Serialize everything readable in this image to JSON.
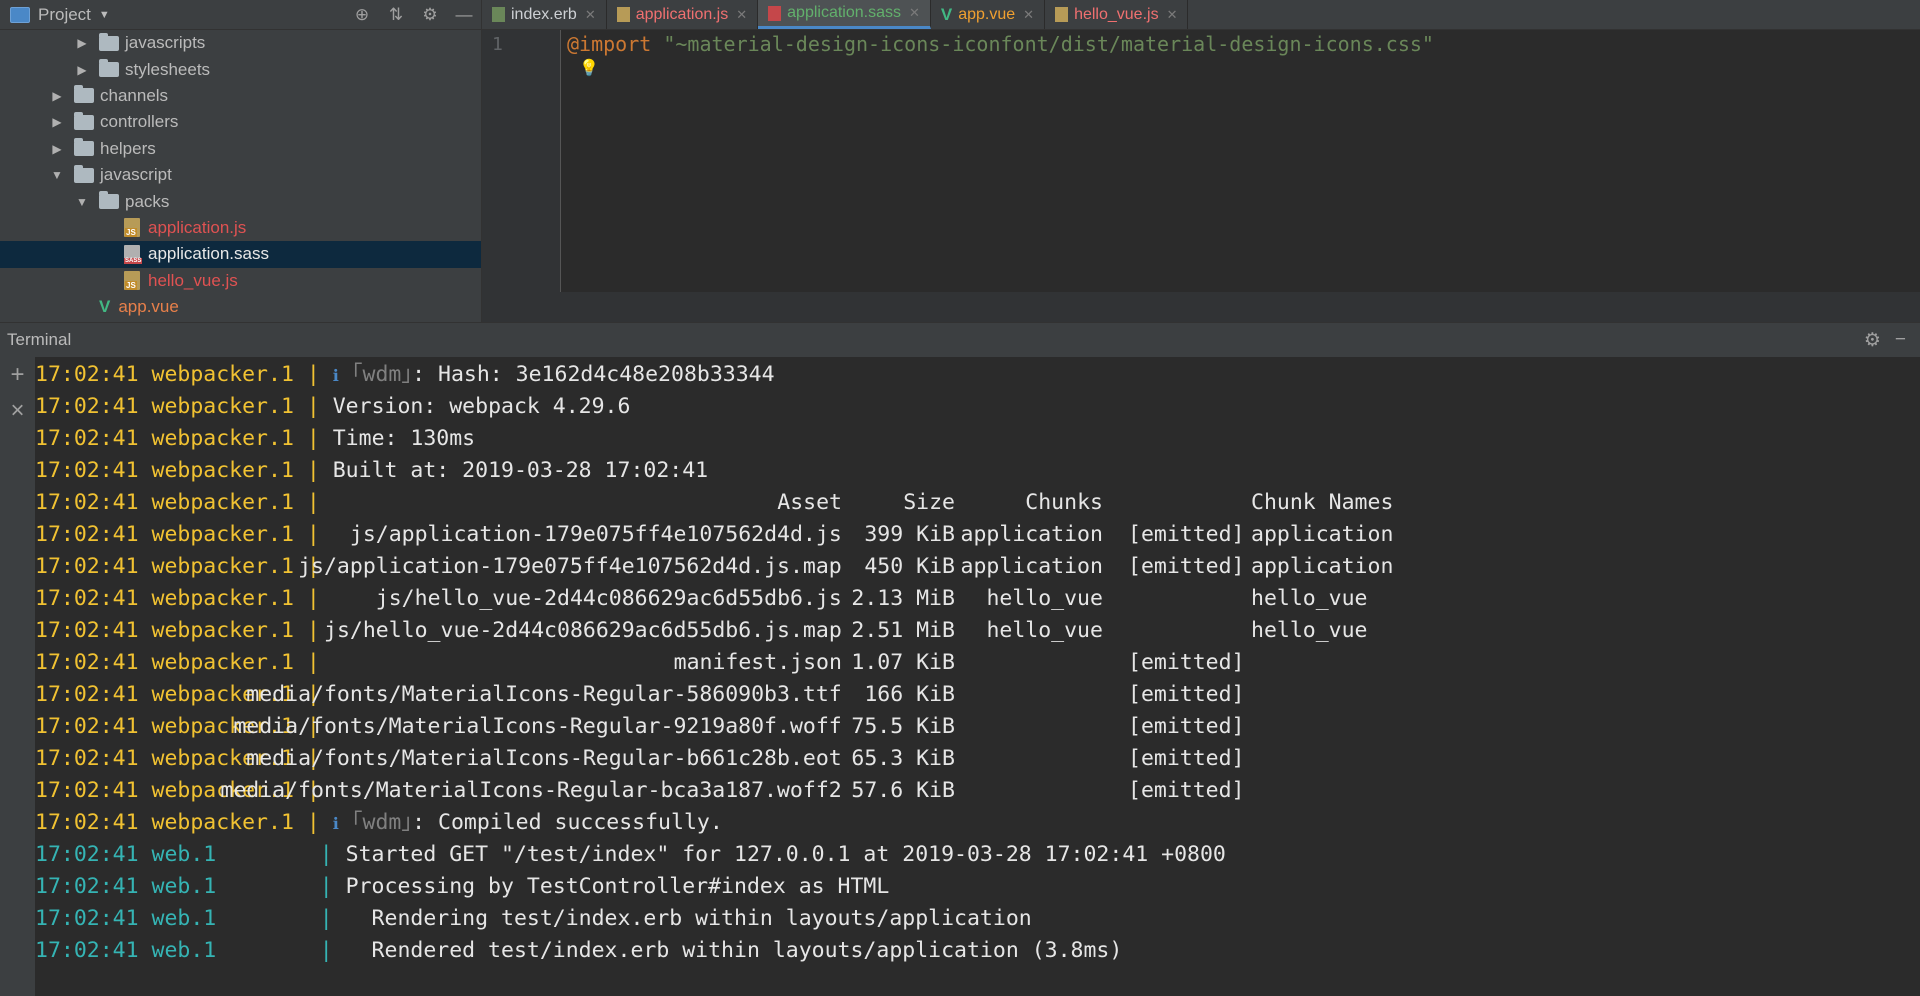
{
  "project": {
    "title": "Project",
    "tree": [
      {
        "label": "javascripts",
        "type": "folder",
        "level": 2,
        "expanded": false,
        "color": "normal"
      },
      {
        "label": "stylesheets",
        "type": "folder",
        "level": 2,
        "expanded": false,
        "color": "normal"
      },
      {
        "label": "channels",
        "type": "folder",
        "level": 1,
        "expanded": false,
        "color": "normal"
      },
      {
        "label": "controllers",
        "type": "folder",
        "level": 1,
        "expanded": false,
        "color": "normal"
      },
      {
        "label": "helpers",
        "type": "folder",
        "level": 1,
        "expanded": false,
        "color": "normal"
      },
      {
        "label": "javascript",
        "type": "folder",
        "level": 1,
        "expanded": true,
        "color": "normal"
      },
      {
        "label": "packs",
        "type": "folder",
        "level": 2,
        "expanded": true,
        "color": "normal"
      },
      {
        "label": "application.js",
        "type": "js",
        "level": 3,
        "color": "red"
      },
      {
        "label": "application.sass",
        "type": "sass",
        "level": 3,
        "color": "white",
        "selected": true
      },
      {
        "label": "hello_vue.js",
        "type": "js",
        "level": 3,
        "color": "red"
      },
      {
        "label": "app.vue",
        "type": "vue",
        "level": 2,
        "color": "vue"
      }
    ]
  },
  "editor": {
    "tabs": [
      {
        "label": "index.erb",
        "kind": "erb"
      },
      {
        "label": "application.js",
        "kind": "js"
      },
      {
        "label": "application.sass",
        "kind": "sass",
        "active": true
      },
      {
        "label": "app.vue",
        "kind": "vue"
      },
      {
        "label": "hello_vue.js",
        "kind": "hello"
      }
    ],
    "line_number": "1",
    "code": {
      "keyword": "@import",
      "string": "\"~material-design-icons-iconfont/dist/material-design-icons.css\""
    }
  },
  "terminal": {
    "title": "Terminal",
    "lines": [
      {
        "prefix": "17:02:41 webpacker.1",
        "source": "wp",
        "text": "Hash: 3e162d4c48e208b33344",
        "wdm": true
      },
      {
        "prefix": "17:02:41 webpacker.1",
        "source": "wp",
        "text": "Version: webpack 4.29.6"
      },
      {
        "prefix": "17:02:41 webpacker.1",
        "source": "wp",
        "text": "Time: 130ms"
      },
      {
        "prefix": "17:02:41 webpacker.1",
        "source": "wp",
        "text": "Built at: 2019-03-28 17:02:41"
      },
      {
        "prefix": "17:02:41 webpacker.1",
        "source": "wp",
        "table": [
          "Asset",
          "Size",
          "Chunks",
          "",
          "Chunk Names"
        ]
      },
      {
        "prefix": "17:02:41 webpacker.1",
        "source": "wp",
        "table": [
          "js/application-179e075ff4e107562d4d.js",
          "399 KiB",
          "application",
          "[emitted]",
          "application"
        ]
      },
      {
        "prefix": "17:02:41 webpacker.1",
        "source": "wp",
        "table": [
          "js/application-179e075ff4e107562d4d.js.map",
          "450 KiB",
          "application",
          "[emitted]",
          "application"
        ]
      },
      {
        "prefix": "17:02:41 webpacker.1",
        "source": "wp",
        "table": [
          "js/hello_vue-2d44c086629ac6d55db6.js",
          "2.13 MiB",
          "hello_vue",
          "",
          "hello_vue"
        ]
      },
      {
        "prefix": "17:02:41 webpacker.1",
        "source": "wp",
        "table": [
          "js/hello_vue-2d44c086629ac6d55db6.js.map",
          "2.51 MiB",
          "hello_vue",
          "",
          "hello_vue"
        ]
      },
      {
        "prefix": "17:02:41 webpacker.1",
        "source": "wp",
        "table": [
          "manifest.json",
          "1.07 KiB",
          "",
          "[emitted]",
          ""
        ]
      },
      {
        "prefix": "17:02:41 webpacker.1",
        "source": "wp",
        "table": [
          "media/fonts/MaterialIcons-Regular-586090b3.ttf",
          "166 KiB",
          "",
          "[emitted]",
          ""
        ]
      },
      {
        "prefix": "17:02:41 webpacker.1",
        "source": "wp",
        "table": [
          "media/fonts/MaterialIcons-Regular-9219a80f.woff",
          "75.5 KiB",
          "",
          "[emitted]",
          ""
        ]
      },
      {
        "prefix": "17:02:41 webpacker.1",
        "source": "wp",
        "table": [
          "media/fonts/MaterialIcons-Regular-b661c28b.eot",
          "65.3 KiB",
          "",
          "[emitted]",
          ""
        ]
      },
      {
        "prefix": "17:02:41 webpacker.1",
        "source": "wp",
        "table": [
          "media/fonts/MaterialIcons-Regular-bca3a187.woff2",
          "57.6 KiB",
          "",
          "[emitted]",
          ""
        ]
      },
      {
        "prefix": "17:02:41 webpacker.1",
        "source": "wp",
        "text": "Compiled successfully.",
        "wdm": true
      },
      {
        "prefix": "17:02:41 web.1       ",
        "source": "web",
        "text": "Started GET \"/test/index\" for 127.0.0.1 at 2019-03-28 17:02:41 +0800"
      },
      {
        "prefix": "17:02:41 web.1       ",
        "source": "web",
        "text": "Processing by TestController#index as HTML"
      },
      {
        "prefix": "17:02:41 web.1       ",
        "source": "web",
        "text": "  Rendering test/index.erb within layouts/application"
      },
      {
        "prefix": "17:02:41 web.1       ",
        "source": "web",
        "text": "  Rendered test/index.erb within layouts/application (3.8ms)"
      }
    ],
    "wdm_label": "｢wdm｣",
    "info_glyph": "ℹ"
  },
  "colors": {
    "webpacker": "#f1c232",
    "web": "#35b4b4",
    "selection": "#0d293e"
  }
}
